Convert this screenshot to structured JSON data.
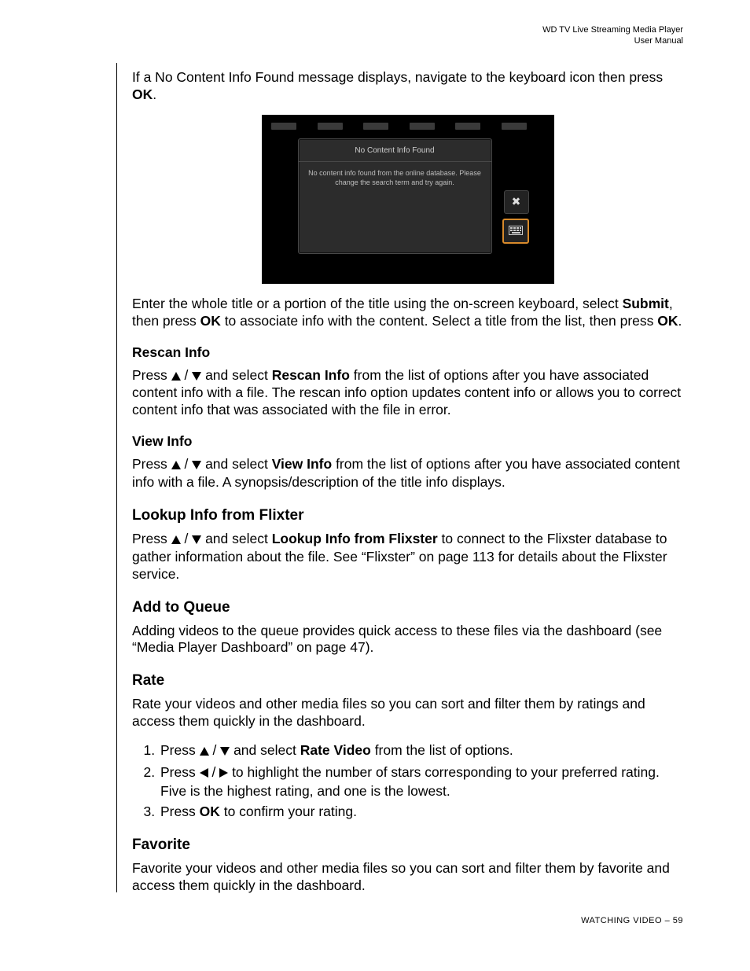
{
  "header": {
    "line1": "WD TV Live Streaming Media Player",
    "line2": "User Manual"
  },
  "intro": {
    "p1_a": "If a No Content Info Found message displays, navigate to the keyboard icon then press ",
    "p1_b": "OK",
    "p1_c": "."
  },
  "screenshot": {
    "title": "No Content Info Found",
    "body": "No content info found from the online database. Please change the search term and try again.",
    "close_symbol": "✖",
    "close_name": "close-icon",
    "keyboard_name": "keyboard-icon"
  },
  "after_shot": {
    "a": "Enter the whole title or a portion of the title using the on-screen keyboard, select ",
    "b": "Submit",
    "c": ", then press ",
    "d": "OK",
    "e": " to associate info with the content. Select a title from the list, then press ",
    "f": "OK",
    "g": "."
  },
  "rescan": {
    "heading": "Rescan Info",
    "a": "Press ",
    "b": " and select ",
    "c": "Rescan Info",
    "d": " from the list of options after you have associated content info with a file. The rescan info option updates content info or allows you to correct content info that was associated with the file in error."
  },
  "view": {
    "heading": "View Info",
    "a": "Press ",
    "b": " and select ",
    "c": "View Info",
    "d": " from the list of options after you have associated content info with a file. A synopsis/description of the title info displays."
  },
  "lookup": {
    "heading": "Lookup Info from Flixter",
    "a": "Press ",
    "b": " and select ",
    "c": "Lookup Info from Flixster",
    "d": " to connect to the Flixster database to gather information about the file. See “Flixster” on page 113 for details about the Flixster service."
  },
  "queue": {
    "heading": "Add to Queue",
    "p": "Adding videos to the queue provides quick access to these files via the dashboard (see “Media Player Dashboard” on page 47)."
  },
  "rate": {
    "heading": "Rate",
    "p": "Rate your videos and other media files so you can sort and filter them by ratings and access them quickly in the dashboard.",
    "s1a": "Press ",
    "s1b": " and select ",
    "s1c": "Rate Video",
    "s1d": " from the list of options.",
    "s2a": "Press ",
    "s2b": " to highlight the number of stars corresponding to your preferred rating. Five is the highest rating, and one is the lowest.",
    "s3a": "Press ",
    "s3b": "OK",
    "s3c": " to confirm your rating."
  },
  "favorite": {
    "heading": "Favorite",
    "p": "Favorite your videos and other media files so you can sort and filter them by favorite and access them quickly in the dashboard."
  },
  "footer": {
    "label": "WATCHING VIDEO",
    "sep": " – ",
    "page": "59"
  }
}
